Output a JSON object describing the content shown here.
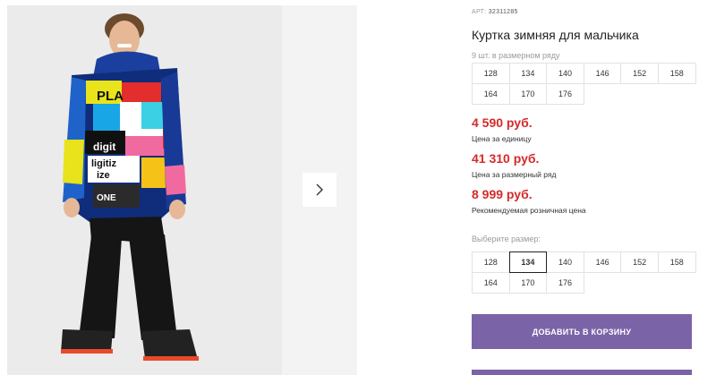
{
  "product": {
    "sku_label": "АРТ:",
    "sku": "32311285",
    "title": "Куртка зимняя для мальчика",
    "pack_note": "9 шт. в размерном ряду"
  },
  "pack_sizes": [
    "128",
    "134",
    "140",
    "146",
    "152",
    "158",
    "164",
    "170",
    "176"
  ],
  "prices": {
    "unit_price": "4 590 руб.",
    "unit_label": "Цена за единицу",
    "pack_price": "41 310 руб.",
    "pack_label": "Цена за размерный ряд",
    "retail_price": "8 999 руб.",
    "retail_label": "Рекомендуемая розничная цена"
  },
  "size_picker": {
    "label": "Выберите размер:",
    "options": [
      "128",
      "134",
      "140",
      "146",
      "152",
      "158",
      "164",
      "170",
      "176"
    ],
    "selected": "134"
  },
  "actions": {
    "add_to_cart": "ДОБАВИТЬ В КОРЗИНУ"
  },
  "photo": {
    "jacket_text": [
      "PLA",
      "digit",
      "ligitiz",
      "ize",
      "ONE"
    ]
  },
  "colors": {
    "price_red": "#d52a2a",
    "button_purple": "#7b63a8",
    "gallery_bg": "#ebebeb"
  }
}
